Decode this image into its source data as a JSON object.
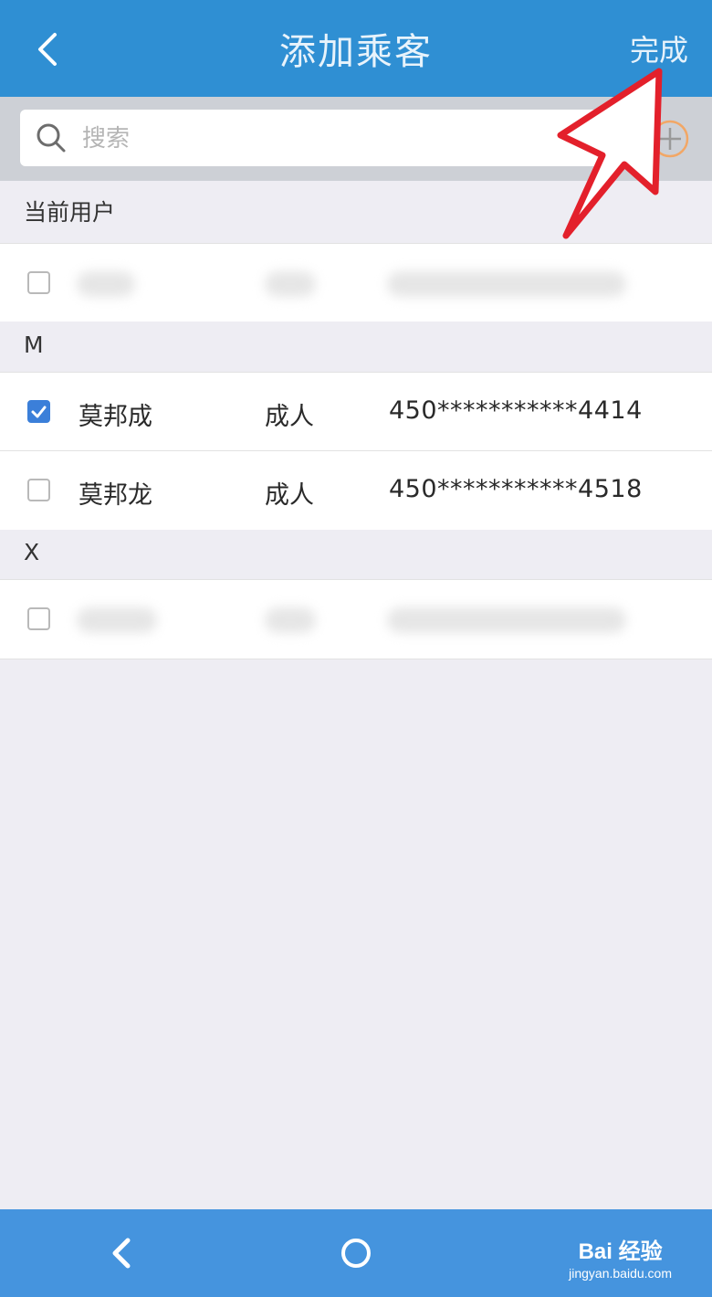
{
  "header": {
    "title": "添加乘客",
    "done_label": "完成"
  },
  "search": {
    "placeholder": "搜索"
  },
  "sections": {
    "current_user": "当前用户",
    "m": "M",
    "x": "X"
  },
  "passengers": [
    {
      "name": "莫邦成",
      "type": "成人",
      "id": "450***********4414",
      "checked": true
    },
    {
      "name": "莫邦龙",
      "type": "成人",
      "id": "450***********4518",
      "checked": false
    }
  ],
  "watermark": {
    "brand": "Bai 经验",
    "url": "jingyan.baidu.com"
  },
  "colors": {
    "topbar": "#2f8fd3",
    "accent": "#3b7fd9",
    "annotation_arrow": "#e3202b"
  }
}
